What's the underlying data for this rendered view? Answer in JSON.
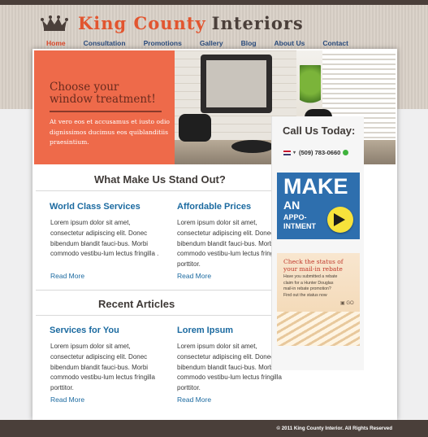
{
  "brand": {
    "part1": "King County",
    "part2": "Interiors"
  },
  "nav": [
    {
      "label": "Home",
      "active": true
    },
    {
      "label": "Consultation"
    },
    {
      "label": "Promotions"
    },
    {
      "label": "Gallery"
    },
    {
      "label": "Blog"
    },
    {
      "label": "About Us"
    },
    {
      "label": "Contact"
    }
  ],
  "hero": {
    "title_line1": "Choose your",
    "title_line2": "window treatment!",
    "text": "At vero eos et accusamus et iusto odio dignissimos ducimus eos quiblanditiis praesintium."
  },
  "stand_out": {
    "heading": "What Make Us Stand Out?",
    "columns": [
      {
        "title": "World Class Services",
        "text": "Lorem ipsum dolor sit amet, consectetur adipiscing elit. Donec bibendum blandit fauci-bus. Morbi commodo vestibu-lum lectus fringilla .",
        "link": "Read More"
      },
      {
        "title": "Affordable Prices",
        "text": "Lorem ipsum dolor sit amet, consectetur adipiscing elit. Donec bibendum blandit fauci-bus. Morbi commodo vestibu-lum lectus fringilla porttitor.",
        "link": "Read More"
      }
    ]
  },
  "articles": {
    "heading": "Recent Articles",
    "columns": [
      {
        "title": "Services for You",
        "text": "Lorem ipsum dolor sit amet, consectetur adipiscing elit. Donec bibendum blandit fauci-bus. Morbi commodo vestibu-lum lectus fringilla porttitor.",
        "link": "Read More"
      },
      {
        "title": "Lorem Ipsum",
        "text": "Lorem ipsum dolor sit amet, consectetur adipiscing elit. Donec bibendum blandit fauci-bus. Morbi commodo vestibu-lum lectus fringilla porttitor.",
        "link": "Read More"
      }
    ]
  },
  "sidebar": {
    "call_title": "Call Us Today:",
    "phone": "(509) 783-0660",
    "make": {
      "big": "MAKE",
      "an": "AN",
      "appo_line1": "APPO-",
      "appo_line2": "INTMENT"
    },
    "rebate": {
      "title": "Check the status of your mail-in rebate",
      "text": "Have you submitted a rebate claim for a Hunter Douglas mail-in rebate promotion? Find out the status now",
      "go": "GO"
    }
  },
  "footer": {
    "text": "© 2011 King County Interior. All Rights Reserved"
  },
  "colors": {
    "accent": "#e2552f",
    "nav": "#2a4b7c",
    "link": "#1b6aa0",
    "dark": "#4a3f3a",
    "promo": "#2e6fae"
  }
}
